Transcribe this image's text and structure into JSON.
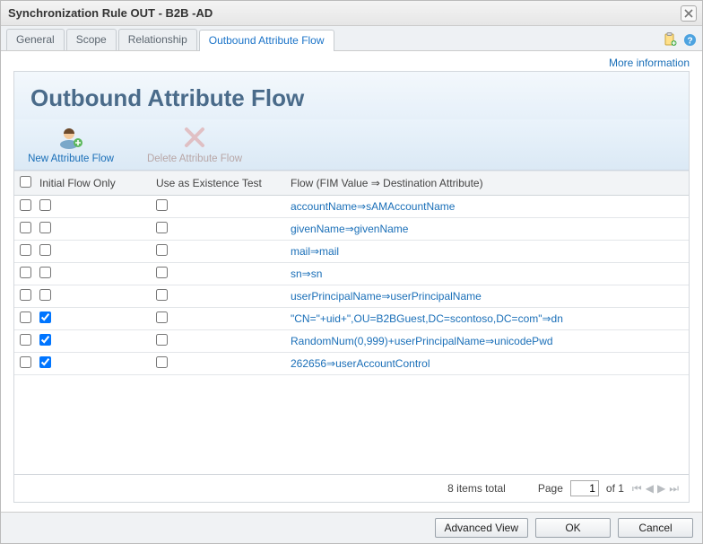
{
  "window": {
    "title": "Synchronization Rule OUT - B2B -AD"
  },
  "tabs": [
    {
      "label": "General",
      "active": false
    },
    {
      "label": "Scope",
      "active": false
    },
    {
      "label": "Relationship",
      "active": false
    },
    {
      "label": "Outbound Attribute Flow",
      "active": true
    }
  ],
  "links": {
    "more_info": "More information"
  },
  "heading": "Outbound Attribute Flow",
  "toolbar": {
    "new_flow": {
      "label": "New Attribute Flow",
      "disabled": false
    },
    "delete_flow": {
      "label": "Delete Attribute Flow",
      "disabled": true
    }
  },
  "table": {
    "columns": {
      "select": "",
      "initial_flow_only": "Initial Flow Only",
      "use_as_existence": "Use as Existence Test",
      "flow": "Flow (FIM Value ⇒ Destination Attribute)"
    },
    "rows": [
      {
        "initial": false,
        "existence": false,
        "flow": "accountName⇒sAMAccountName"
      },
      {
        "initial": false,
        "existence": false,
        "flow": "givenName⇒givenName"
      },
      {
        "initial": false,
        "existence": false,
        "flow": "mail⇒mail"
      },
      {
        "initial": false,
        "existence": false,
        "flow": "sn⇒sn"
      },
      {
        "initial": false,
        "existence": false,
        "flow": "userPrincipalName⇒userPrincipalName"
      },
      {
        "initial": true,
        "existence": false,
        "flow": "\"CN=\"+uid+\",OU=B2BGuest,DC=scontoso,DC=com\"⇒dn"
      },
      {
        "initial": true,
        "existence": false,
        "flow": "RandomNum(0,999)+userPrincipalName⇒unicodePwd"
      },
      {
        "initial": true,
        "existence": false,
        "flow": "262656⇒userAccountControl"
      }
    ]
  },
  "pager": {
    "total_text": "8 items total",
    "page_label": "Page",
    "current": "1",
    "of_label": "of 1"
  },
  "footer": {
    "advanced": "Advanced View",
    "ok": "OK",
    "cancel": "Cancel"
  }
}
